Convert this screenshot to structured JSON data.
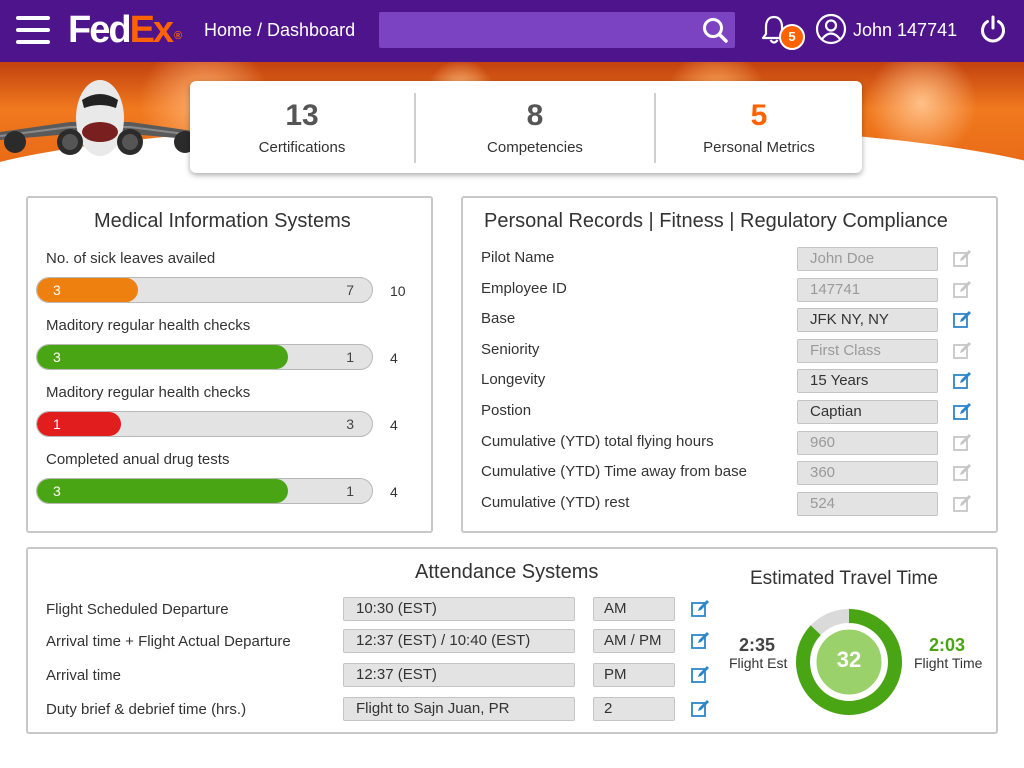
{
  "brand": {
    "fed": "Fed",
    "ex": "Ex",
    "reg": "®"
  },
  "header": {
    "breadcrumb": "Home / Dashboard",
    "search_placeholder": "",
    "notifications_count": "5",
    "username": "John 147741"
  },
  "icons": {
    "menu": "hamburger-icon",
    "search": "search-icon",
    "bell": "bell-icon",
    "user": "user-icon",
    "power": "power-icon",
    "edit": "edit-icon",
    "plane": "airplane-image"
  },
  "colors": {
    "brand_purple": "#4d148c",
    "brand_orange": "#ff6200",
    "orange": "#ee8010",
    "green": "#4aa514",
    "red": "#e11d1d",
    "ring_gray": "#dadada",
    "edit_blue": "#2c86c8"
  },
  "kpis": [
    {
      "value": "13",
      "label": "Certifications",
      "color": "#555555"
    },
    {
      "value": "8",
      "label": "Competencies",
      "color": "#555555"
    },
    {
      "value": "5",
      "label": "Personal Metrics",
      "color": "#ff6200"
    }
  ],
  "medical": {
    "title": "Medical Information Systems",
    "rows": [
      {
        "label": "No. of sick leaves availed",
        "value": "3",
        "remaining": "7",
        "total": "10",
        "fraction": 0.3,
        "color": "#ee8010"
      },
      {
        "label": "Maditory regular health checks",
        "value": "3",
        "remaining": "1",
        "total": "4",
        "fraction": 0.75,
        "color": "#4aa514"
      },
      {
        "label": "Maditory regular health checks",
        "value": "1",
        "remaining": "3",
        "total": "4",
        "fraction": 0.25,
        "color": "#e11d1d"
      },
      {
        "label": "Completed anual drug tests",
        "value": "3",
        "remaining": "1",
        "total": "4",
        "fraction": 0.75,
        "color": "#4aa514"
      }
    ]
  },
  "records": {
    "title": "Personal Records | Fitness | Regulatory Compliance",
    "rows": [
      {
        "label": "Pilot Name",
        "value": "John Doe",
        "editable": false
      },
      {
        "label": "Employee ID",
        "value": "147741",
        "editable": false
      },
      {
        "label": "Base",
        "value": "JFK NY, NY",
        "editable": true
      },
      {
        "label": "Seniority",
        "value": "First Class",
        "editable": false
      },
      {
        "label": "Longevity",
        "value": "15 Years",
        "editable": true
      },
      {
        "label": "Postion",
        "value": "Captian",
        "editable": true
      },
      {
        "label": "Cumulative (YTD) total flying hours",
        "value": "960",
        "editable": false
      },
      {
        "label": "Cumulative (YTD) Time away from base",
        "value": "360",
        "editable": false
      },
      {
        "label": "Cumulative (YTD) rest",
        "value": "524",
        "editable": false
      }
    ]
  },
  "attendance": {
    "title": "Attendance Systems",
    "rows": [
      {
        "label": "Flight Scheduled Departure",
        "value": "10:30 (EST)",
        "value2": "AM"
      },
      {
        "label": "Arrival time + Flight Actual Departure",
        "value": "12:37 (EST) / 10:40 (EST)",
        "value2": "AM / PM"
      },
      {
        "label": "Arrival time",
        "value": "12:37 (EST)",
        "value2": "PM"
      },
      {
        "label": "Duty brief & debrief time (hrs.)",
        "value": "Flight to Sajn Juan, PR",
        "value2": "2"
      }
    ]
  },
  "travel": {
    "title": "Estimated Travel Time",
    "center_value": "32",
    "left_value": "2:35",
    "left_label": "Flight Est",
    "right_value": "2:03",
    "right_label": "Flight Time",
    "green_fraction": 0.87
  }
}
